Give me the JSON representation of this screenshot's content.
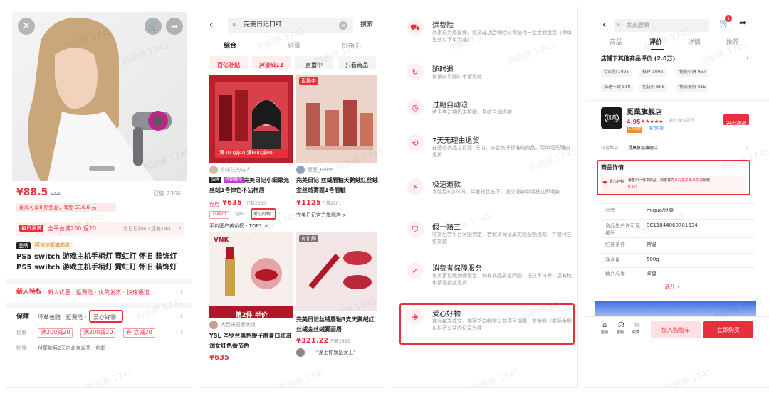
{
  "panel1": {
    "price": "¥88.5",
    "price_old": "¥16",
    "sold": "已售 2366",
    "promo_line": "最高可享8 期免息，每期 216.6 元",
    "daily_badge": "每日满送",
    "daily_text": "全平台满200 返20",
    "daily_right": "今日已购60 还差140",
    "brand_badge": "品牌",
    "brand_shop": "阿迪达斯旗舰店",
    "title_line1": "PS5 switch 游戏主机手柄灯 霓虹灯 怀旧 装饰灯",
    "title_line2": "PS5 switch 游戏主机手柄灯 霓虹灯 怀旧 装饰灯",
    "newuser_label": "新人特权",
    "newuser_text": "新人优惠 · 运费险 · 优先发货 · 快速通道",
    "guarantee_label": "保障",
    "guarantee_text": "坏单包赔 · 运费险 ·",
    "guarantee_highlight": "爱心好物",
    "discount_label": "优惠",
    "coupons": [
      "满200减20",
      "满200减20",
      "券 立减20"
    ],
    "logistics_label": "物流",
    "logistics_text": "付尾款后2天内北京发货 | 包邮",
    "colors": {
      "accent": "#e8303d",
      "pink_bg": "#ffe8ea",
      "magenta": "#c0238a"
    }
  },
  "panel2": {
    "search_value": "完美日记口红",
    "search_button": "搜索",
    "tabs": [
      "综合",
      "销量",
      "价格↕"
    ],
    "chips": [
      "百亿补贴",
      "抖音双11",
      "直播中",
      "只看商品"
    ],
    "card1": {
      "banner": "满300减40 满600减80",
      "user": "你关注的达人",
      "badge1": "品牌",
      "badge2": "好物推荐",
      "title": "完美日记小细跟光丝绒1号掉色不沾杯唇",
      "price": "¥635",
      "price_label": "券后",
      "sold": "已售2883",
      "tag1": "立减20",
      "tag2": "包邮",
      "tag3": "爱心好物",
      "rank": "平价国产美妆榜 · TOP1 >"
    },
    "card2": {
      "live": "直播中",
      "user": "豆豆_Bebe",
      "title": "完美日记 丝绒唇釉天鹅绒红丝绒金丝绒雾面1号唇釉",
      "price": "¥1125",
      "sold": "已售2901",
      "shop": "完美日记官方旗舰店 >"
    },
    "card3": {
      "user": "大西米君爱美妆",
      "title": "YSL 圣罗兰黑色鞭子唇膏口红滋润女红色番茄色",
      "price": "¥635",
      "banner": "第2件 半价",
      "brand_text": "VNK"
    },
    "card4": {
      "badge": "有讲解",
      "title": "完美日记丝绒唇釉3支天鹅绒红丝绒金丝绒雾面唇",
      "price": "¥321.22",
      "sold": "已售2883",
      "comment": "\"涂上你就是女王\""
    }
  },
  "panel3": {
    "services": [
      {
        "title": "运费险",
        "desc": "商家已为您投保，退货成功后保险公司赔付一定金额运费（保单生效以下单为准）",
        "icon": "truck-icon"
      },
      {
        "title": "随时退",
        "desc": "核销前可随时申请退款",
        "icon": "refresh-icon"
      },
      {
        "title": "过期自动退",
        "desc": "若卡券过期仍未核销，系统自动退款",
        "icon": "clock-icon"
      },
      {
        "title": "7天无理由退货",
        "desc": "在签收商品之日起7天内，符合完好标准的商品，可申请无理由退货",
        "icon": "return-icon"
      },
      {
        "title": "极速退款",
        "desc": "发起后6小时内，待发货状态下，提交退款申请将立即退款",
        "icon": "lightning-icon"
      },
      {
        "title": "假一赔三",
        "desc": "收货后若平台客服判定，若假货保证属实则全额退款，并赔付三倍货款",
        "icon": "shield-icon"
      },
      {
        "title": "消费者保障服务",
        "desc": "该卖家已缴纳保证金，如有商品质量问题，描述不符等，您有权申请退款或退货",
        "icon": "check-shield-icon"
      },
      {
        "title": "爱心好物",
        "desc": "商品每次成交，商家将向制定公益项目捐赠一定金额（实际金额以抖音公益内记录为准）",
        "icon": "heart-diamond-icon"
      }
    ]
  },
  "panel4": {
    "search_value": "紫皮腰果",
    "cart_count": "1",
    "tabs": [
      "商品",
      "评价",
      "详情",
      "推荐"
    ],
    "active_tab": "评价",
    "reviews_title": "店铺下其他商品评价 (2.0万)",
    "review_tags": [
      "会回购 1095",
      "推荐 1093",
      "物美价廉 957",
      "描述一致 818",
      "包装好 698",
      "物流很好 615"
    ],
    "shop_name": "觅菓旗舰店",
    "shop_rating": "4.95",
    "shop_rating_note": "超过 96% 同行",
    "shop_badge": "5.0小时",
    "shop_badge2": "官方好店",
    "shop_logo_text": "觅菓",
    "enter_shop": "进店逛逛",
    "brand_row_label": "抖音集中",
    "brand_row_value": "觅菓食品旗舰店",
    "detail_title": "商品详情",
    "love_badge": "爱心好物",
    "love_text_a": "每售出一件本商品，商家将向",
    "love_text_b": "乡村孩子未来加油",
    "love_text_c": "捐赠",
    "love_amount": "0.1元",
    "specs": [
      {
        "k": "品牌",
        "v": "miguo/觅菓"
      },
      {
        "k": "食品生产许可证编号",
        "v": "SC11844060701534"
      },
      {
        "k": "贮存条件",
        "v": "常温"
      },
      {
        "k": "净含量",
        "v": "500g"
      },
      {
        "k": "特产品类",
        "v": "坚果"
      }
    ],
    "expand": "展开 ⌄",
    "bottom_icons": [
      "店铺",
      "客服",
      "收藏"
    ],
    "add_cart": "加入购物车",
    "buy_now": "立即购买"
  },
  "watermark": "刘丽婷 1745"
}
